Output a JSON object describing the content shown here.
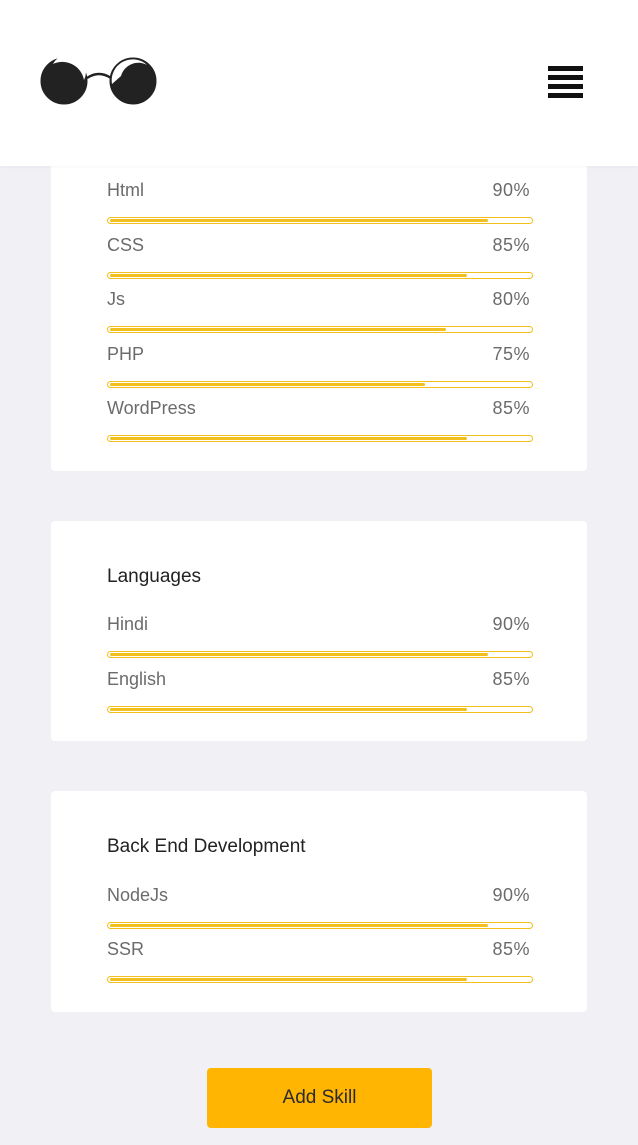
{
  "header": {
    "logo_name": "glasses-logo",
    "menu_icon": "hamburger-menu-icon"
  },
  "colors": {
    "accent": "#f3bf1d",
    "button": "#ffb502",
    "background": "#f0f0f5"
  },
  "cards": [
    {
      "title": "",
      "skills": [
        {
          "name": "Html",
          "percent_label": "90%",
          "percent": 90
        },
        {
          "name": "CSS",
          "percent_label": "85%",
          "percent": 85
        },
        {
          "name": "Js",
          "percent_label": "80%",
          "percent": 80
        },
        {
          "name": "PHP",
          "percent_label": "75%",
          "percent": 75
        },
        {
          "name": "WordPress",
          "percent_label": "85%",
          "percent": 85
        }
      ]
    },
    {
      "title": "Languages",
      "skills": [
        {
          "name": "Hindi",
          "percent_label": "90%",
          "percent": 90
        },
        {
          "name": "English",
          "percent_label": "85%",
          "percent": 85
        }
      ]
    },
    {
      "title": "Back End Development",
      "skills": [
        {
          "name": "NodeJs",
          "percent_label": "90%",
          "percent": 90
        },
        {
          "name": "SSR",
          "percent_label": "85%",
          "percent": 85
        }
      ]
    }
  ],
  "add_button": {
    "label": "Add Skill"
  }
}
